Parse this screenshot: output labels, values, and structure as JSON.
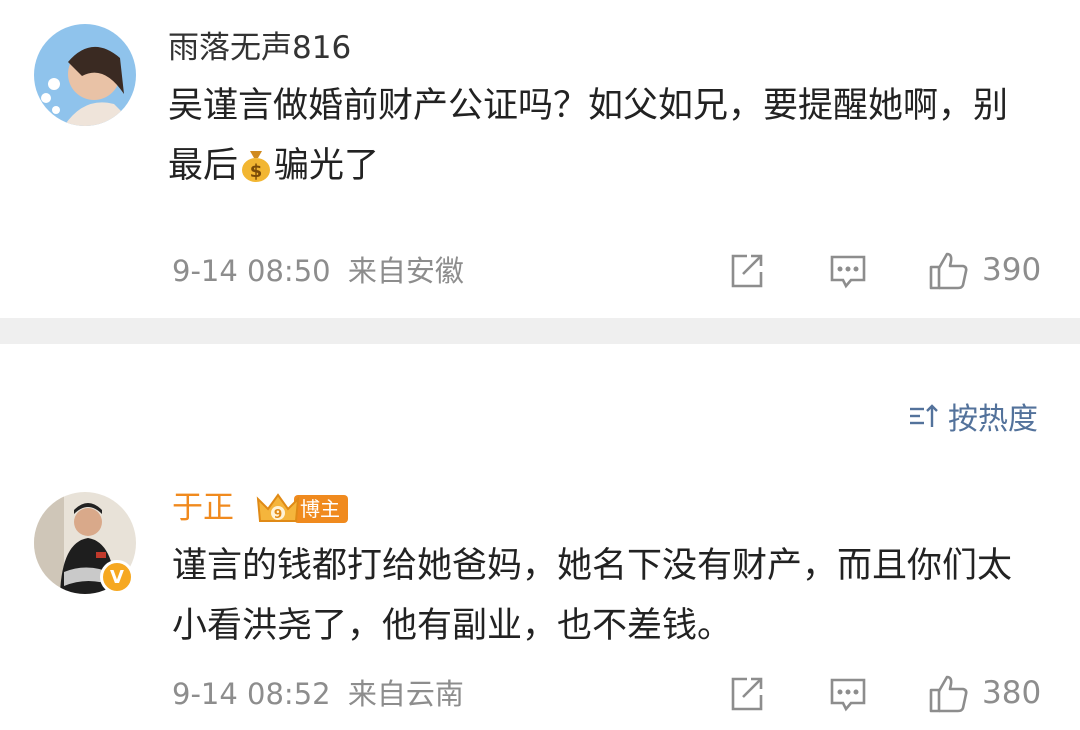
{
  "comments": [
    {
      "username": "雨落无声816",
      "text_part1": "吴谨言做婚前财产公证吗？如父如兄，要提醒她啊，别最后",
      "emoji": "money-bag",
      "text_part2": "骗光了",
      "time": "9-14 08:50",
      "location": "来自安徽",
      "likes": "390"
    },
    {
      "username": "于正",
      "badge": "博主",
      "verified_mark": "V",
      "text": "谨言的钱都打给她爸妈，她名下没有财产，而且你们太小看洪尧了，他有副业，也不差钱。",
      "time": "9-14 08:52",
      "location": "来自云南",
      "likes": "380"
    }
  ],
  "sort": {
    "label": "按热度"
  },
  "colors": {
    "meta": "#8d8d8d",
    "vip_name": "#f08a1e",
    "sort_link": "#53729b",
    "divider": "#efefef"
  }
}
